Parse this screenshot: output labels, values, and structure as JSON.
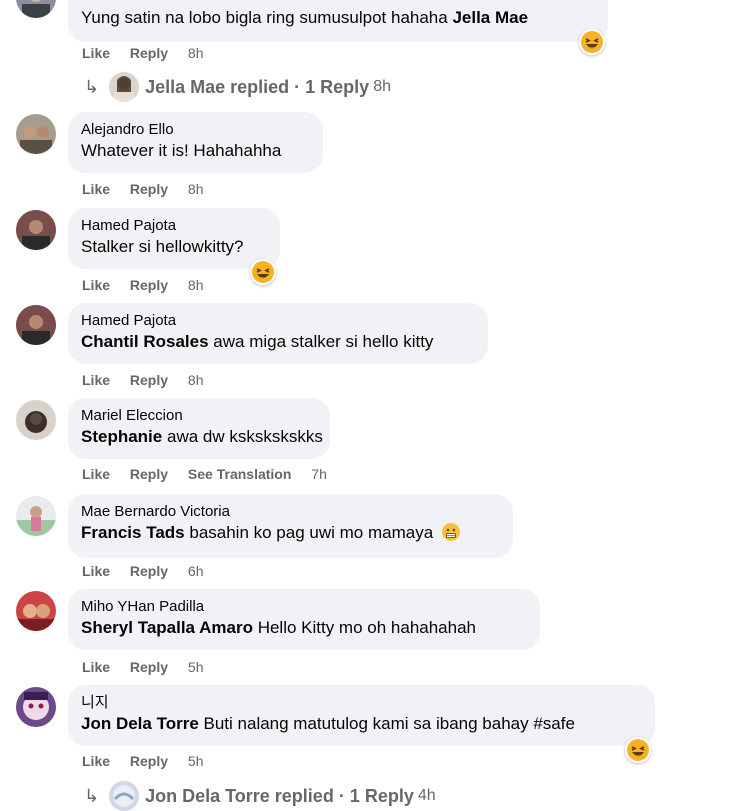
{
  "comments": [
    {
      "author": "",
      "tag": "Jella Mae",
      "text": "Yung satin na lobo bigla ring sumusulpot hahaha",
      "like": "Like",
      "reply": "Reply",
      "time": "8h",
      "reaction": "laugh-emoji"
    },
    {
      "author": "Alejandro Ello",
      "tag": "",
      "text": "Whatever it is! Hahahahha",
      "like": "Like",
      "reply": "Reply",
      "time": "8h"
    },
    {
      "author": "Hamed Pajota",
      "tag": "",
      "text": "Stalker si hellowkitty?",
      "like": "Like",
      "reply": "Reply",
      "time": "8h",
      "reaction": "laugh-emoji"
    },
    {
      "author": "Hamed Pajota",
      "tag": "Chantil Rosales",
      "text": "awa miga stalker si hello kitty",
      "like": "Like",
      "reply": "Reply",
      "time": "8h"
    },
    {
      "author": "Mariel Eleccion",
      "tag": "Stephanie",
      "text": "awa dw kskskskskks",
      "like": "Like",
      "reply": "Reply",
      "see_translation": "See Translation",
      "time": "7h"
    },
    {
      "author": "Mae Bernardo Victoria",
      "tag": "Francis Tads",
      "text": "basahin ko pag uwi mo mamaya",
      "like": "Like",
      "reply": "Reply",
      "time": "6h",
      "inline_emoji": "grimace-emoji"
    },
    {
      "author": "Miho YHan Padilla",
      "tag": "Sheryl Tapalla Amaro",
      "text": "Hello Kitty mo oh hahahahah",
      "like": "Like",
      "reply": "Reply",
      "time": "5h"
    },
    {
      "author": "니지",
      "tag": "Jon Dela Torre",
      "text": "Buti nalang matutulog kami sa ibang bahay #safe",
      "like": "Like",
      "reply": "Reply",
      "time": "5h",
      "reaction": "laugh-emoji"
    }
  ],
  "reply_threads": [
    {
      "text": "Jella Mae replied · 1 Reply",
      "time": "8h"
    },
    {
      "text": "Jon Dela Torre replied · 1 Reply",
      "time": "4h"
    }
  ],
  "colors": {
    "bubble": "#f0f2f5",
    "meta": "#65676b",
    "text": "#050505"
  }
}
